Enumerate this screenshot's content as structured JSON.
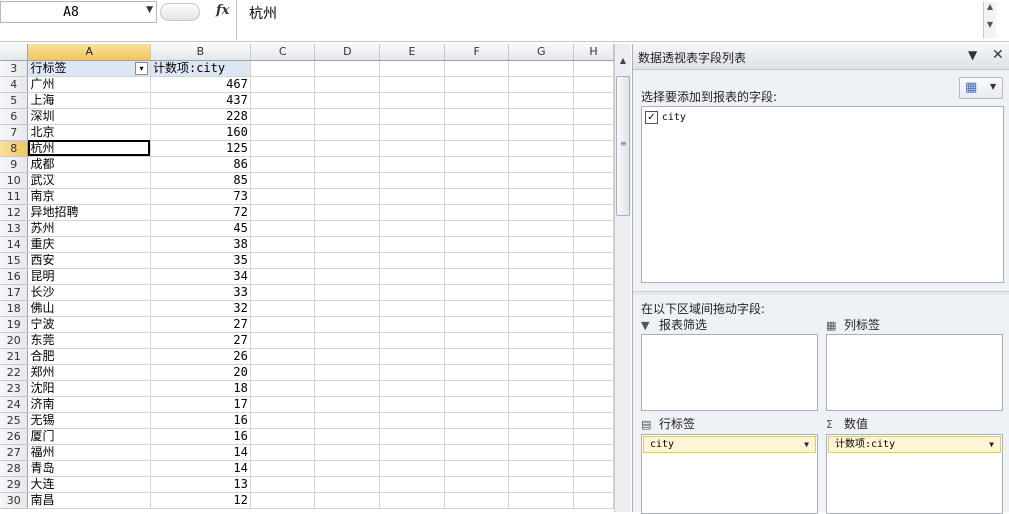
{
  "formula_bar": {
    "name_box": "A8",
    "fx": "fx",
    "value": "杭州"
  },
  "columns": [
    "A",
    "B",
    "C",
    "D",
    "E",
    "F",
    "G",
    "H"
  ],
  "selected_column": "A",
  "header_row": {
    "row": "3",
    "col_a": "行标签",
    "col_b": "计数项:city",
    "filter_arrow": "▾"
  },
  "selected_row": "8",
  "rows": [
    {
      "row": "4",
      "city": "广州",
      "count": "467"
    },
    {
      "row": "5",
      "city": "上海",
      "count": "437"
    },
    {
      "row": "6",
      "city": "深圳",
      "count": "228"
    },
    {
      "row": "7",
      "city": "北京",
      "count": "160"
    },
    {
      "row": "8",
      "city": "杭州",
      "count": "125"
    },
    {
      "row": "9",
      "city": "成都",
      "count": "86"
    },
    {
      "row": "10",
      "city": "武汉",
      "count": "85"
    },
    {
      "row": "11",
      "city": "南京",
      "count": "73"
    },
    {
      "row": "12",
      "city": "异地招聘",
      "count": "72"
    },
    {
      "row": "13",
      "city": "苏州",
      "count": "45"
    },
    {
      "row": "14",
      "city": "重庆",
      "count": "38"
    },
    {
      "row": "15",
      "city": "西安",
      "count": "35"
    },
    {
      "row": "16",
      "city": "昆明",
      "count": "34"
    },
    {
      "row": "17",
      "city": "长沙",
      "count": "33"
    },
    {
      "row": "18",
      "city": "佛山",
      "count": "32"
    },
    {
      "row": "19",
      "city": "宁波",
      "count": "27"
    },
    {
      "row": "20",
      "city": "东莞",
      "count": "27"
    },
    {
      "row": "21",
      "city": "合肥",
      "count": "26"
    },
    {
      "row": "22",
      "city": "郑州",
      "count": "20"
    },
    {
      "row": "23",
      "city": "沈阳",
      "count": "18"
    },
    {
      "row": "24",
      "city": "济南",
      "count": "17"
    },
    {
      "row": "25",
      "city": "无锡",
      "count": "16"
    },
    {
      "row": "26",
      "city": "厦门",
      "count": "16"
    },
    {
      "row": "27",
      "city": "福州",
      "count": "14"
    },
    {
      "row": "28",
      "city": "青岛",
      "count": "14"
    },
    {
      "row": "29",
      "city": "大连",
      "count": "13"
    },
    {
      "row": "30",
      "city": "南昌",
      "count": "12"
    }
  ],
  "pivot": {
    "title": "数据透视表字段列表",
    "choose_fields_label": "选择要添加到报表的字段:",
    "fields": [
      {
        "name": "city",
        "checked": "✓"
      }
    ],
    "drag_label": "在以下区域间拖动字段:",
    "report_filter_label": "报表筛选",
    "column_labels_label": "列标签",
    "row_labels_label": "行标签",
    "values_label": "数值",
    "row_field": "city",
    "value_field": "计数项:city"
  }
}
